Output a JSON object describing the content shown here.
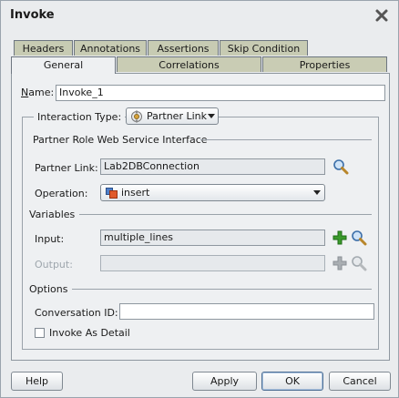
{
  "window": {
    "title": "Invoke"
  },
  "tabs_back": [
    {
      "label": "Headers"
    },
    {
      "label": "Annotations"
    },
    {
      "label": "Assertions"
    },
    {
      "label": "Skip Condition"
    }
  ],
  "tabs_front": [
    {
      "label": "General",
      "active": true
    },
    {
      "label": "Correlations",
      "active": false
    },
    {
      "label": "Properties",
      "active": false
    }
  ],
  "general": {
    "name_label": "Name:",
    "name_value": "Invoke_1",
    "interaction_type_label": "Interaction Type:",
    "interaction_type_value": "Partner Link",
    "partner_section": "Partner Role Web Service Interface",
    "partner_link_label": "Partner Link:",
    "partner_link_value": "Lab2DBConnection",
    "operation_label": "Operation:",
    "operation_value": "insert",
    "variables_section": "Variables",
    "input_label": "Input:",
    "input_value": "multiple_lines",
    "output_label": "Output:",
    "output_value": "",
    "options_section": "Options",
    "conversation_id_label": "Conversation ID:",
    "conversation_id_value": "",
    "invoke_as_detail_label": "Invoke As Detail",
    "invoke_as_detail_checked": false
  },
  "buttons": {
    "help": "Help",
    "apply": "Apply",
    "ok": "OK",
    "cancel": "Cancel"
  },
  "colors": {
    "tab_inactive": "#c9ccb4",
    "panel_bg": "#eef0f2",
    "add_icon_green": "#3a9a2b"
  }
}
